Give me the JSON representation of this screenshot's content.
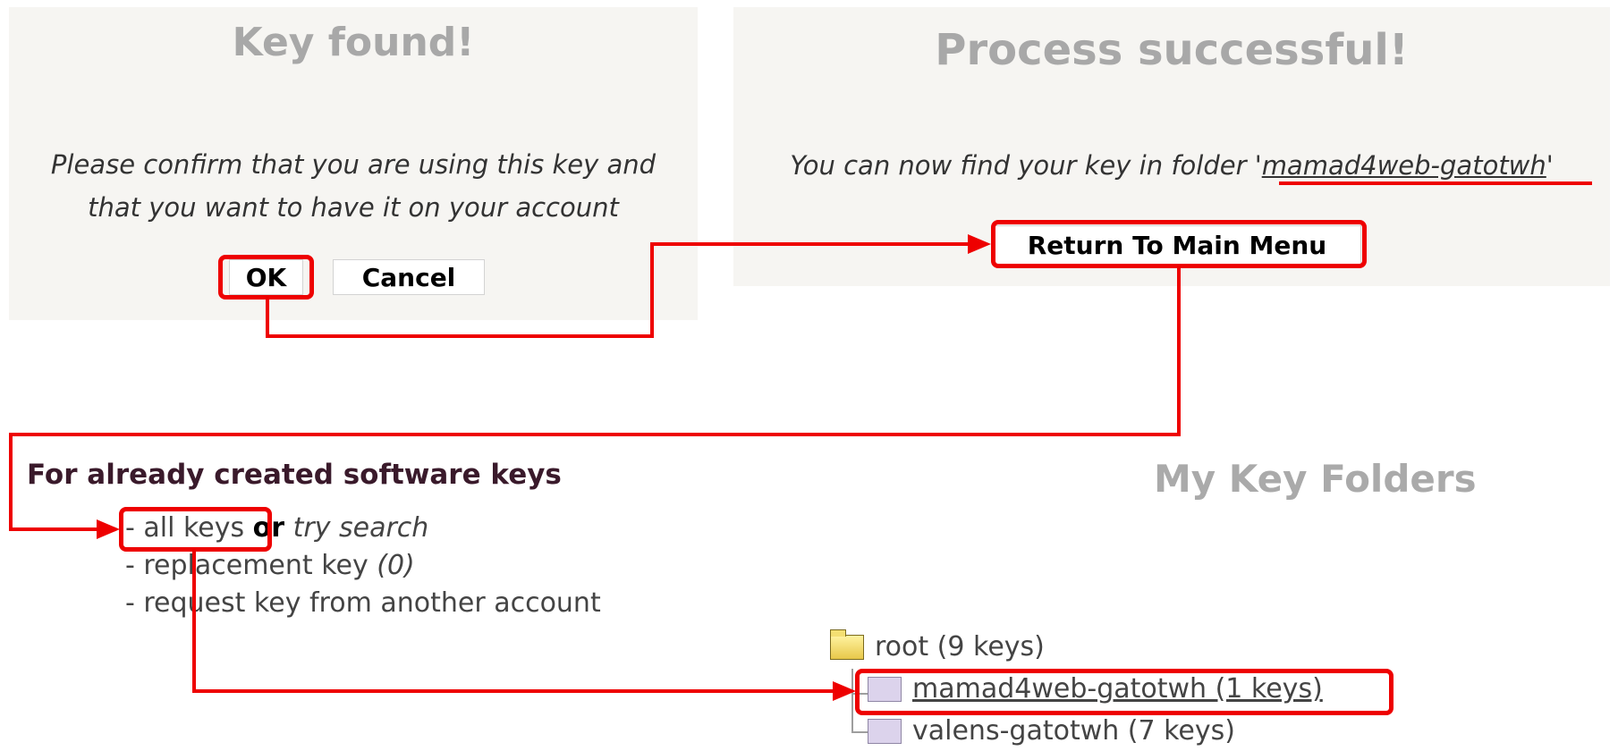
{
  "dialog_confirm": {
    "title": "Key found!",
    "message_line1": "Please confirm that you are using this key and",
    "message_line2": "that you want to have it on your account",
    "ok_label": "OK",
    "cancel_label": "Cancel"
  },
  "dialog_success": {
    "title": "Process successful!",
    "message_prefix": "You can now find your key in folder '",
    "folder_name": "mamad4web-gatotwh",
    "message_suffix": "'",
    "return_label": "Return To Main Menu"
  },
  "software_keys": {
    "heading": "For already created software keys",
    "all_keys": "- all keys",
    "or": "or",
    "try_search": "try search",
    "replacement_key": "- replacement key",
    "replacement_count": "(0)",
    "request_key": "- request key from another account"
  },
  "key_folders": {
    "title": "My Key Folders",
    "root": "root (9 keys)",
    "folder_1": "mamad4web-gatotwh (1 keys)",
    "folder_2": "valens-gatotwh (7 keys)"
  },
  "annotation": {
    "highlight_color": "#ee0000"
  }
}
